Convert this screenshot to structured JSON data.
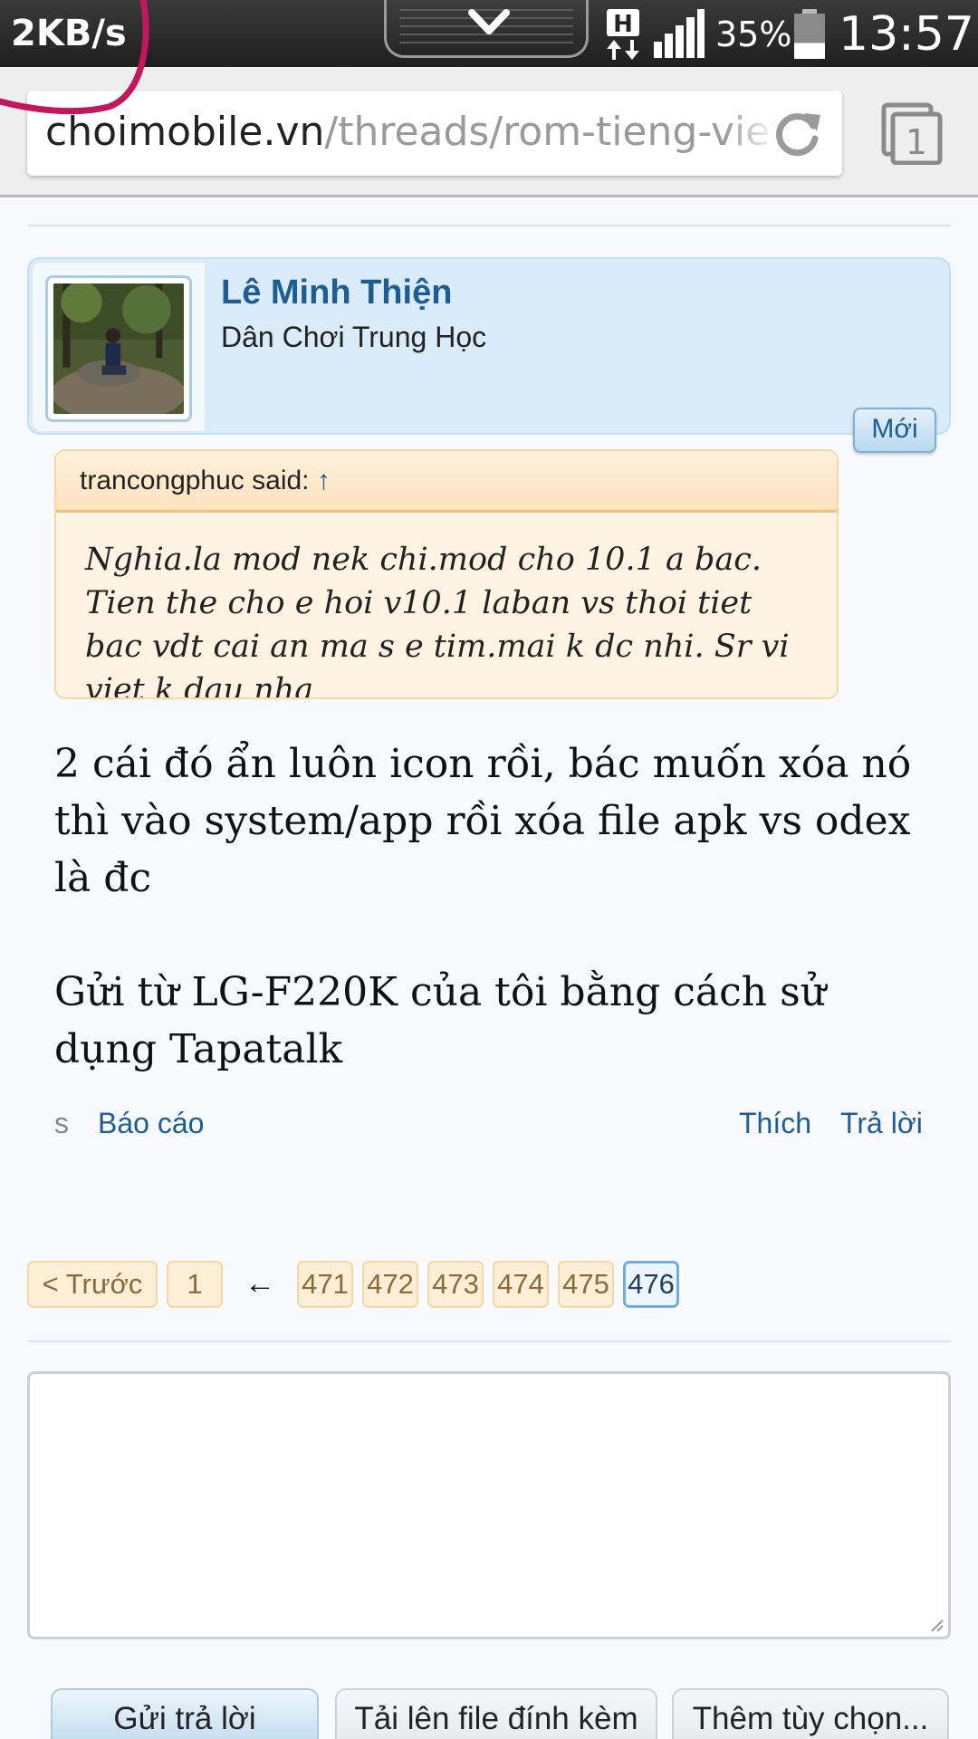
{
  "status_bar": {
    "net_speed": "2KB/s",
    "network_type": "H",
    "battery_percent": "35%",
    "battery_level": 0.35,
    "time": "13:57",
    "icons": [
      "pull-down-tab-icon",
      "hspa-data-icon",
      "signal-icon",
      "battery-icon"
    ]
  },
  "browser": {
    "url_domain": "choimobile.vn",
    "url_path": "/threads/rom-tieng-viet-",
    "tab_count": "1",
    "icons": [
      "reload-icon",
      "tabs-icon"
    ]
  },
  "post": {
    "author_name": "Lê Minh Thiện",
    "author_title": "Dân Chơi Trung Học",
    "new_badge": "Mới",
    "quote": {
      "author": "trancongphuc said:",
      "arrow": "↑",
      "text": "Nghia.la mod nek chi.mod cho 10.1 a bac. Tien the cho e hoi v10.1 laban vs thoi tiet bac vdt cai an ma s e tim.mai k dc nhi. Sr vi viet k dau nha"
    },
    "message_lines": [
      "2 cái đó ẩn luôn icon rồi, bác muốn xóa nó thì vào system/app rồi xóa file apk vs odex là đc",
      "Gửi từ LG-F220K của tôi bằng cách sử dụng Tapatalk"
    ],
    "actions": {
      "prefix": "s",
      "report": "Báo cáo",
      "like": "Thích",
      "reply": "Trả lời"
    }
  },
  "pagination": {
    "prev": "< Trước",
    "first": "1",
    "jump_arrow": "←",
    "pages": [
      "471",
      "472",
      "473",
      "474",
      "475",
      "476"
    ],
    "current": "476"
  },
  "reply_form": {
    "textarea_value": "",
    "submit": "Gửi trả lời",
    "upload": "Tải lên file đính kèm",
    "more_options": "Thêm tùy chọn..."
  },
  "colors": {
    "link_blue": "#1e5d93",
    "annotation_red": "#c2185b",
    "page_button_bg": "#fdeed6"
  }
}
